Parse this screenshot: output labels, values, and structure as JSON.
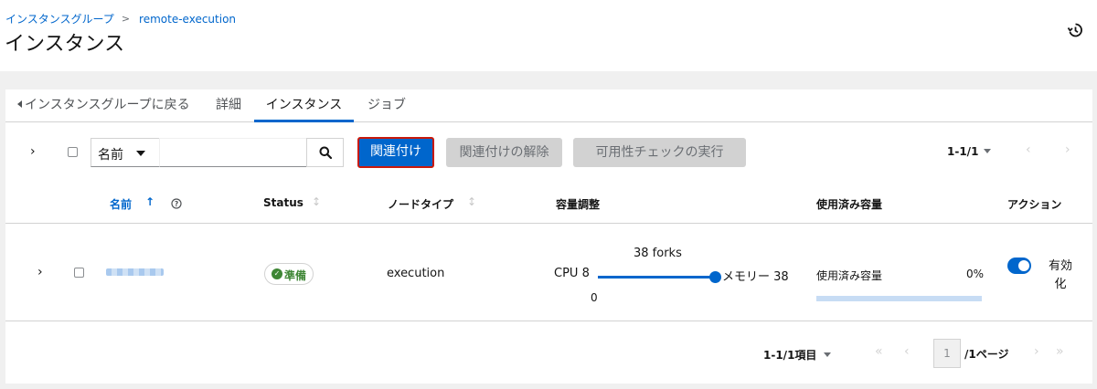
{
  "breadcrumb": {
    "parent": "インスタンスグループ",
    "separator": ">",
    "current": "remote-execution"
  },
  "page": {
    "title": "インスタンス"
  },
  "tabs": [
    {
      "label": "インスタンスグループに戻る"
    },
    {
      "label": "詳細"
    },
    {
      "label": "インスタンス",
      "active": true
    },
    {
      "label": "ジョブ"
    }
  ],
  "toolbar": {
    "filter_select": "名前",
    "search_value": "",
    "associate_label": "関連付け",
    "disassociate_label": "関連付けの解除",
    "health_check_label": "可用性チェックの実行",
    "pagination": "1-1/1"
  },
  "table": {
    "headers": {
      "name": "名前",
      "status": "Status",
      "node_type": "ノードタイプ",
      "capacity_adjustment": "容量調整",
      "used_capacity": "使用済み容量",
      "actions": "アクション"
    },
    "rows": [
      {
        "status": "準備",
        "node_type": "execution",
        "forks": "38 forks",
        "cpu": "CPU 8",
        "memory": "メモリー 38",
        "slider_min": "0",
        "slider_value": 1.0,
        "used_label": "使用済み容量",
        "used_percent": "0%",
        "enabled_label": "有効化",
        "enabled": true
      }
    ]
  },
  "pagination": {
    "summary": "1-1/1項目",
    "page": "1",
    "of_pages": "/1ページ"
  },
  "colors": {
    "primary": "#0066cc",
    "success": "#3e8635",
    "highlight_border": "#c9190b"
  }
}
